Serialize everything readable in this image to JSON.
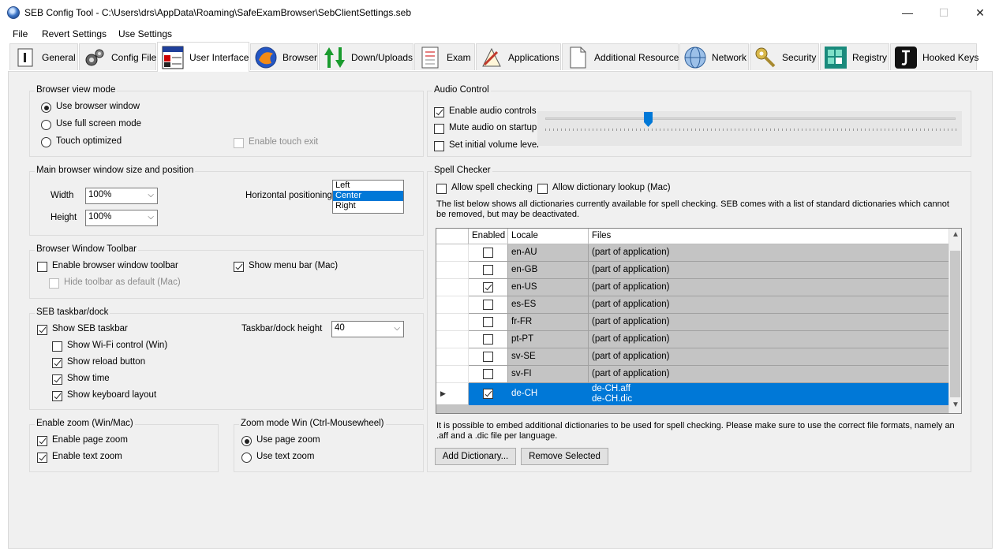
{
  "window": {
    "title": "SEB Config Tool - C:\\Users\\drs\\AppData\\Roaming\\SafeExamBrowser\\SebClientSettings.seb",
    "minimize_glyph": "—",
    "maximize_glyph": "☐",
    "close_glyph": "✕"
  },
  "menu": [
    "File",
    "Revert Settings",
    "Use Settings"
  ],
  "tabs": [
    {
      "label": "General",
      "icon": "general-icon"
    },
    {
      "label": "Config File",
      "icon": "config-file-icon"
    },
    {
      "label": "User Interface",
      "icon": "user-interface-icon",
      "active": true
    },
    {
      "label": "Browser",
      "icon": "browser-icon"
    },
    {
      "label": "Down/Uploads",
      "icon": "down-uploads-icon"
    },
    {
      "label": "Exam",
      "icon": "exam-icon"
    },
    {
      "label": "Applications",
      "icon": "applications-icon"
    },
    {
      "label": "Additional Resources",
      "icon": "additional-resources-icon"
    },
    {
      "label": "Network",
      "icon": "network-icon"
    },
    {
      "label": "Security",
      "icon": "security-icon"
    },
    {
      "label": "Registry",
      "icon": "registry-icon"
    },
    {
      "label": "Hooked Keys",
      "icon": "hooked-keys-icon"
    }
  ],
  "browser_view_mode": {
    "title": "Browser view mode",
    "use_browser_window": "Use browser window",
    "use_full_screen": "Use full screen mode",
    "touch_optimized": "Touch optimized",
    "enable_touch_exit": "Enable touch exit"
  },
  "window_size": {
    "title": "Main browser window size and position",
    "width_label": "Width",
    "width_value": "100%",
    "height_label": "Height",
    "height_value": "100%",
    "horizontal_label": "Horizontal positioning",
    "positions": [
      "Left",
      "Center",
      "Right"
    ]
  },
  "toolbar": {
    "title": "Browser Window Toolbar",
    "enable_toolbar": "Enable browser window toolbar",
    "show_menu_bar": "Show menu bar (Mac)",
    "hide_toolbar": "Hide toolbar as default (Mac)"
  },
  "taskbar": {
    "title": "SEB taskbar/dock",
    "show_taskbar": "Show SEB taskbar",
    "height_label": "Taskbar/dock height",
    "height_value": "40",
    "show_wifi": "Show Wi-Fi control (Win)",
    "show_reload": "Show reload button",
    "show_time": "Show time",
    "show_keyboard": "Show keyboard layout"
  },
  "zoom": {
    "title": "Enable zoom (Win/Mac)",
    "page_zoom": "Enable page zoom",
    "text_zoom": "Enable text zoom"
  },
  "zoom_mode": {
    "title": "Zoom mode Win (Ctrl-Mousewheel)",
    "use_page_zoom": "Use page zoom",
    "use_text_zoom": "Use text zoom"
  },
  "audio": {
    "title": "Audio Control",
    "enable_audio": "Enable audio controls",
    "mute_audio": "Mute audio on startup",
    "set_volume": "Set initial volume level",
    "volume_fraction": 0.25
  },
  "spell": {
    "title": "Spell Checker",
    "allow_spell": "Allow spell checking",
    "allow_dict": "Allow dictionary lookup (Mac)",
    "description": "The list below shows all dictionaries currently available for spell checking. SEB comes with a list of standard dictionaries which cannot be removed, but may be deactivated.",
    "columns": [
      "Enabled",
      "Locale",
      "Files"
    ],
    "rows": [
      {
        "locale": "en-AU",
        "files": "(part of application)",
        "enabled": false
      },
      {
        "locale": "en-GB",
        "files": "(part of application)",
        "enabled": false
      },
      {
        "locale": "en-US",
        "files": "(part of application)",
        "enabled": true
      },
      {
        "locale": "es-ES",
        "files": "(part of application)",
        "enabled": false
      },
      {
        "locale": "fr-FR",
        "files": "(part of application)",
        "enabled": false
      },
      {
        "locale": "pt-PT",
        "files": "(part of application)",
        "enabled": false
      },
      {
        "locale": "sv-SE",
        "files": "(part of application)",
        "enabled": false
      },
      {
        "locale": "sv-FI",
        "files": "(part of application)",
        "enabled": false
      }
    ],
    "selected_row": {
      "locale": "de-CH",
      "file1": "de-CH.aff",
      "file2": "de-CH.dic",
      "enabled": true
    },
    "footer": "It is possible to embed additional dictionaries to be used for spell checking. Please make sure to use the correct file formats, namely an .aff and a .dic file per language.",
    "add_button": "Add Dictionary...",
    "remove_button": "Remove Selected"
  }
}
